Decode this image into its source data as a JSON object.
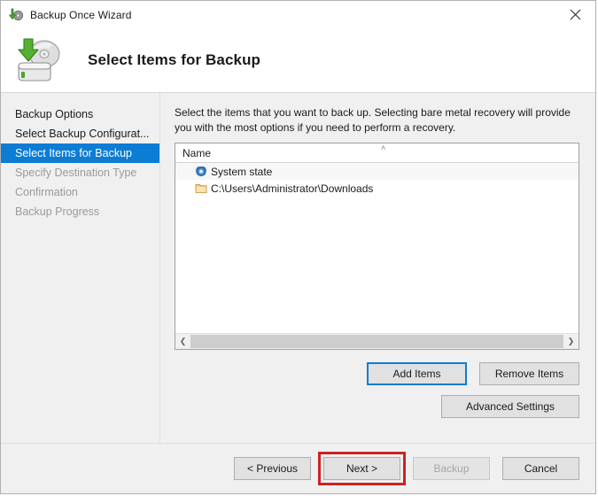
{
  "window": {
    "title": "Backup Once Wizard",
    "title_icon": "backup-disk-icon",
    "close_label": "✕"
  },
  "header": {
    "title": "Select Items for Backup",
    "icon": "hard-drive-disc-arrow-icon"
  },
  "sidebar": {
    "items": [
      {
        "label": "Backup Options",
        "state": "done"
      },
      {
        "label": "Select Backup Configurat...",
        "state": "done"
      },
      {
        "label": "Select Items for Backup",
        "state": "current"
      },
      {
        "label": "Specify Destination Type",
        "state": "pending"
      },
      {
        "label": "Confirmation",
        "state": "pending"
      },
      {
        "label": "Backup Progress",
        "state": "pending"
      }
    ]
  },
  "main": {
    "instruction": "Select the items that you want to back up. Selecting bare metal recovery will provide you with the most options if you need to perform a recovery.",
    "list": {
      "column_header": "Name",
      "sort_indicator": "˄",
      "rows": [
        {
          "label": "System state",
          "icon": "system-state-gear-icon"
        },
        {
          "label": "C:\\Users\\Administrator\\Downloads",
          "icon": "folder-icon"
        }
      ]
    },
    "scrollbar": {
      "left_arrow": "❮",
      "right_arrow": "❯"
    },
    "buttons": {
      "add_items": "Add Items",
      "remove_items": "Remove Items",
      "advanced_settings": "Advanced Settings"
    }
  },
  "footer": {
    "previous": "< Previous",
    "next": "Next >",
    "backup": "Backup",
    "cancel": "Cancel"
  },
  "colors": {
    "accent": "#0c7cd5",
    "annotation": "#cc2222",
    "window_bg": "#f0f0f0"
  }
}
